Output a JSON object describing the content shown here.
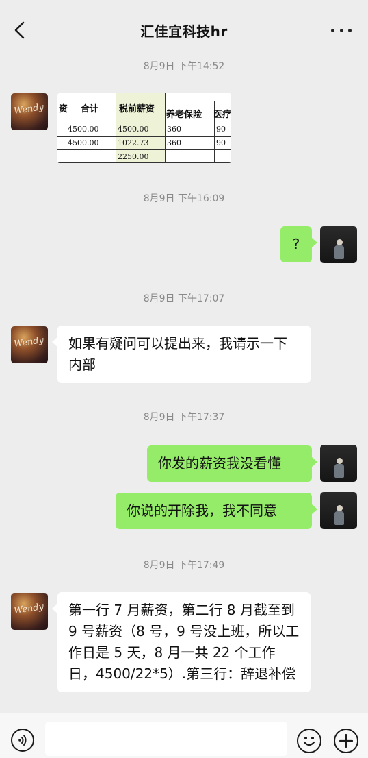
{
  "header": {
    "title": "汇佳宜科技hr",
    "back_icon": "chevron-left-icon",
    "more_icon": "more-dots-icon"
  },
  "messages": {
    "ts1": "8月9日 下午14:52",
    "image_table": {
      "headers": [
        "资",
        "合计",
        "税前薪资",
        "养老保险",
        "医疗"
      ],
      "rows": [
        [
          "4500.00",
          "4500.00",
          "360",
          "90"
        ],
        [
          "4500.00",
          "1022.73",
          "360",
          "90"
        ],
        [
          "",
          "2250.00",
          "",
          ""
        ]
      ]
    },
    "ts2": "8月9日 下午16:09",
    "q": "?",
    "ts3": "8月9日 下午17:07",
    "hr1": "如果有疑问可以提出来，我请示一下内部",
    "ts4": "8月9日 下午17:37",
    "me1": "你发的薪资我没看懂",
    "me2": "你说的开除我，我不同意",
    "ts5": "8月9日 下午17:49",
    "hr2": "第一行 7 月薪资，第二行 8 月截至到 9 号薪资（8 号，9 号没上班，所以工作日是 5 天，8 月一共 22 个工作日，4500/22*5）.第三行：辞退补偿"
  },
  "avatars": {
    "hr_signature": "Wendy"
  },
  "composer": {
    "voice_icon": "voice-icon",
    "emoji_icon": "emoji-icon",
    "plus_icon": "plus-icon"
  },
  "colors": {
    "sent_bubble": "#95ec69",
    "received_bubble": "#ffffff",
    "background": "#ededed"
  }
}
